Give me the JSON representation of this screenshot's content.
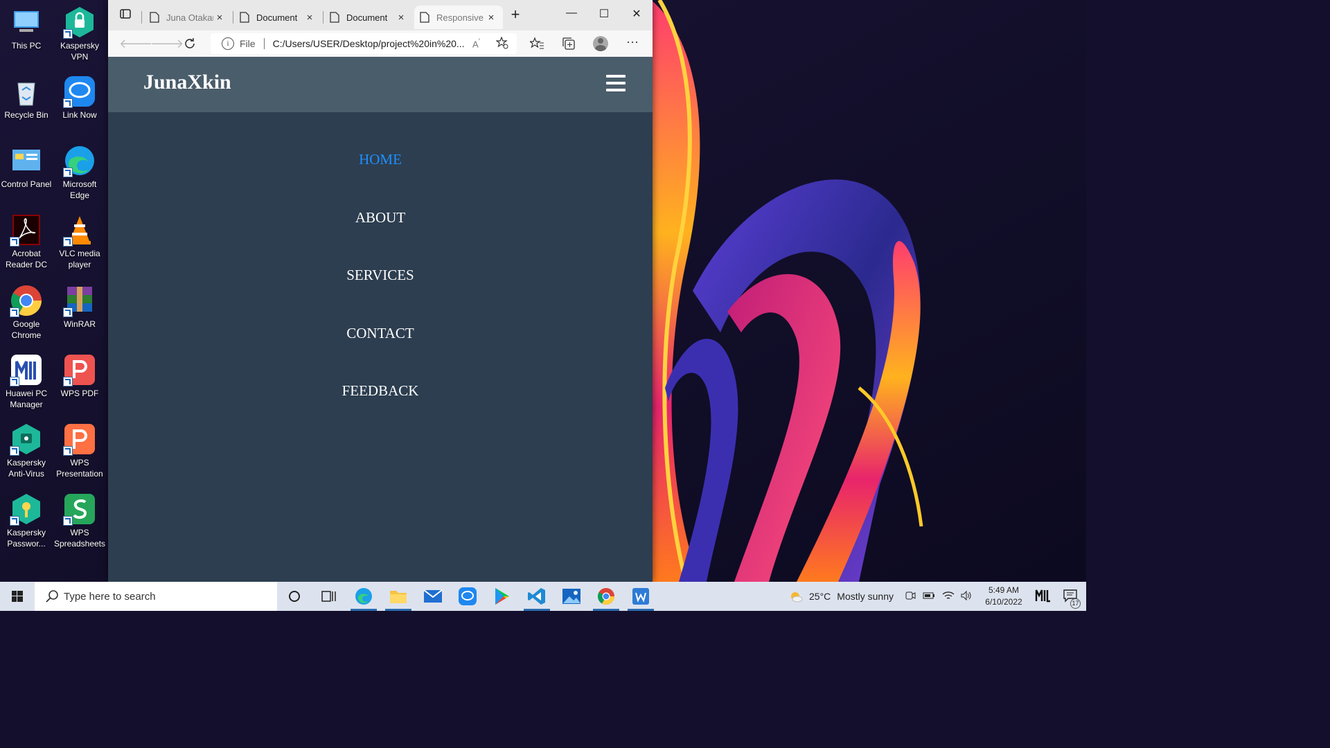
{
  "desktop": {
    "icons": [
      {
        "label": "This PC",
        "icon": "this-pc-icon"
      },
      {
        "label": "Kaspersky VPN",
        "icon": "kaspersky-vpn-icon"
      },
      {
        "label": "Recycle Bin",
        "icon": "recycle-bin-icon"
      },
      {
        "label": "Link Now",
        "icon": "link-now-icon"
      },
      {
        "label": "Control Panel",
        "icon": "control-panel-icon"
      },
      {
        "label": "Microsoft Edge",
        "icon": "edge-icon"
      },
      {
        "label": "Acrobat Reader DC",
        "icon": "acrobat-icon"
      },
      {
        "label": "VLC media player",
        "icon": "vlc-icon"
      },
      {
        "label": "Google Chrome",
        "icon": "chrome-icon"
      },
      {
        "label": "WinRAR",
        "icon": "winrar-icon"
      },
      {
        "label": "Huawei PC Manager",
        "icon": "huawei-pc-manager-icon"
      },
      {
        "label": "WPS PDF",
        "icon": "wps-pdf-icon"
      },
      {
        "label": "Kaspersky Anti-Virus",
        "icon": "kaspersky-antivirus-icon"
      },
      {
        "label": "WPS Presentation",
        "icon": "wps-presentation-icon"
      },
      {
        "label": "Kaspersky Passwor...",
        "icon": "kaspersky-password-icon"
      },
      {
        "label": "WPS Spreadsheets",
        "icon": "wps-spreadsheets-icon"
      }
    ]
  },
  "browser": {
    "tabs": [
      {
        "title": "Juna Otakar",
        "close": "×"
      },
      {
        "title": "Document",
        "close": "×"
      },
      {
        "title": "Document",
        "close": "×"
      },
      {
        "title": "Responsive",
        "close": "×",
        "active": true
      }
    ],
    "new_tab": "+",
    "window_controls": {
      "minimize": "—",
      "maximize": "☐",
      "close": "✕"
    },
    "address": {
      "scheme": "File",
      "url": "C:/Users/USER/Desktop/project%20in%20...",
      "read_aloud": "A̩"
    }
  },
  "site": {
    "brand": "JunaXkin",
    "menu": [
      "HOME",
      "ABOUT",
      "SERVICES",
      "CONTACT",
      "FEEDBACK"
    ],
    "active_menu": "HOME",
    "colors": {
      "header": "#4a5d6b",
      "body": "#2d3e50",
      "active": "#1e90ff"
    }
  },
  "taskbar": {
    "search_placeholder": "Type here to search",
    "weather": {
      "temp": "25°C",
      "desc": "Mostly sunny"
    },
    "clock": {
      "time": "5:49 AM",
      "date": "6/10/2022"
    },
    "notifications": "17"
  }
}
